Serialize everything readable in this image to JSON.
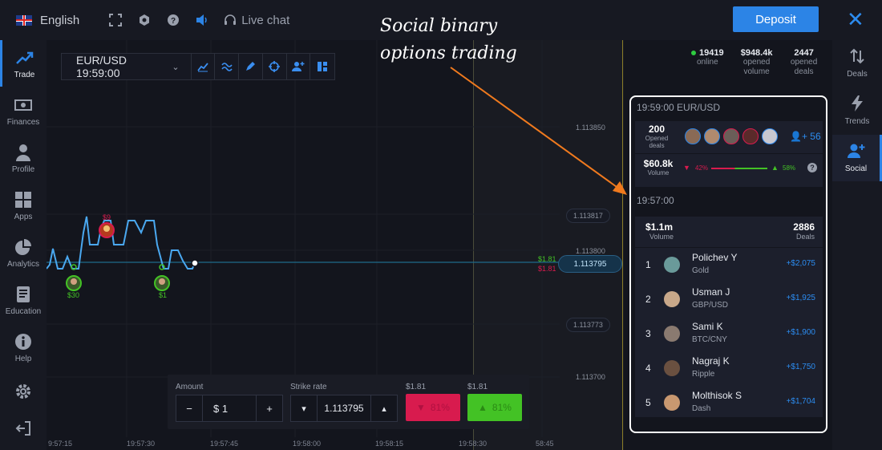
{
  "topbar": {
    "language": "English",
    "live_chat": "Live chat",
    "deposit_label": "Deposit"
  },
  "leftnav": {
    "items": [
      {
        "label": "Trade",
        "icon": "trend-up-icon"
      },
      {
        "label": "Finances",
        "icon": "cash-icon"
      },
      {
        "label": "Profile",
        "icon": "user-icon"
      },
      {
        "label": "Apps",
        "icon": "grid-icon"
      },
      {
        "label": "Analytics",
        "icon": "pie-chart-icon"
      },
      {
        "label": "Education",
        "icon": "book-icon"
      },
      {
        "label": "Help",
        "icon": "info-icon"
      }
    ]
  },
  "chart": {
    "pair_label": "EUR/USD 19:59:00",
    "price_levels": [
      "1.113850",
      "1.113817",
      "1.113800",
      "1.113795",
      "1.113773",
      "1.113700"
    ],
    "current_price": "1.113795",
    "amount_up_label": "$1.81",
    "amount_down_label": "$1.81",
    "deal_labels": {
      "red": "$9",
      "green1": "$30",
      "green2": "$1"
    },
    "time_labels": [
      "9:57:15",
      "19:57:30",
      "19:57:45",
      "19:58:00",
      "19:58:15",
      "19:58:30",
      "58:45"
    ]
  },
  "annotation": {
    "line1": "Social binary",
    "line2": "options trading"
  },
  "stats": {
    "online_value": "19419",
    "online_label": "online",
    "volume_value": "$948.4k",
    "volume_label": "opened volume",
    "deals_value": "2447",
    "deals_label": "opened deals"
  },
  "rightnav": {
    "items": [
      {
        "label": "Deals",
        "icon": "sort-arrows-icon"
      },
      {
        "label": "Trends",
        "icon": "lightning-icon"
      },
      {
        "label": "Social",
        "icon": "add-user-icon"
      }
    ]
  },
  "social": {
    "current_title": "19:59:00 EUR/USD",
    "opened_deals_value": "200",
    "opened_deals_label": "Opened deals",
    "extra_users": "+ 56",
    "volume_value": "$60.8k",
    "volume_label": "Volume",
    "down_pct": "42%",
    "up_pct": "58%",
    "past_title": "19:57:00",
    "past_volume_value": "$1.1m",
    "past_volume_label": "Volume",
    "past_deals_value": "2886",
    "past_deals_label": "Deals",
    "leaders": [
      {
        "rank": "1",
        "name": "Polichev Y",
        "asset": "Gold",
        "profit": "+$2,075"
      },
      {
        "rank": "2",
        "name": "Usman J",
        "asset": "GBP/USD",
        "profit": "+$1,925"
      },
      {
        "rank": "3",
        "name": "Sami K",
        "asset": "BTC/CNY",
        "profit": "+$1,900"
      },
      {
        "rank": "4",
        "name": "Nagraj K",
        "asset": "Ripple",
        "profit": "+$1,750"
      },
      {
        "rank": "5",
        "name": "Molthisok S",
        "asset": "Dash",
        "profit": "+$1,704"
      }
    ]
  },
  "trade": {
    "amount_label": "Amount",
    "amount_value": "$ 1",
    "strike_label": "Strike rate",
    "strike_value": "1.113795",
    "down_payout_label": "$1.81",
    "up_payout_label": "$1.81",
    "down_pct": "81%",
    "up_pct": "81%",
    "minus": "−",
    "plus": "+"
  },
  "colors": {
    "accent": "#2c84e6",
    "down": "#d81b4e",
    "up": "#43c225"
  }
}
